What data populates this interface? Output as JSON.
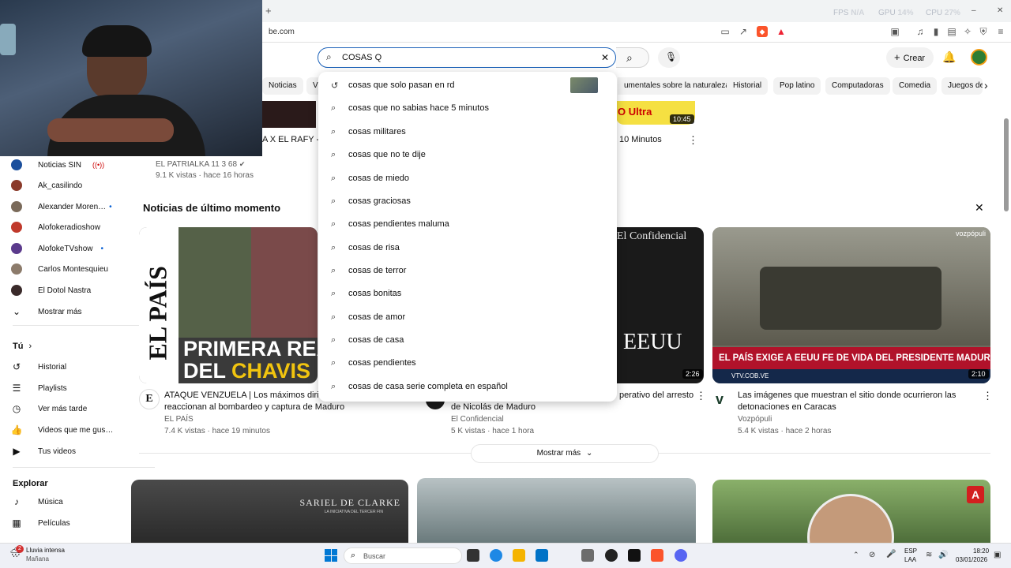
{
  "browser": {
    "url": "be.com",
    "stats": {
      "fps_label": "FPS",
      "fps_value": "N/A",
      "gpu_label": "GPU",
      "gpu_value": "14%",
      "cpu_label": "CPU",
      "cpu_value": "27%"
    },
    "new_tab": "+"
  },
  "header": {
    "search_value": "COSAS Q",
    "create_label": "Crear"
  },
  "chips": [
    "Noticias",
    "V",
    "umentales sobre la naturaleza",
    "Historial",
    "Pop latino",
    "Computadoras",
    "Comedia",
    "Juegos de"
  ],
  "top_partial": {
    "title_left": "A X EL RAFY - I",
    "title_right": "10 Minutos",
    "channel": "EL PATRIALKA 11 3 68",
    "meta": "9.1 K vistas · hace 16 horas",
    "duration": "10:45",
    "thumb_text": "O   Ultra"
  },
  "sidebar": {
    "subs": [
      {
        "name": "Noticias SIN",
        "live": true,
        "color": "#1b4f9c"
      },
      {
        "name": "Ak_casilindo",
        "color": "#8a3a2a"
      },
      {
        "name": "Alexander Moren…",
        "dot": true,
        "color": "#7a6a5a"
      },
      {
        "name": "Alofokeradioshow",
        "color": "#c0392b"
      },
      {
        "name": "AlofokeTVshow",
        "dot": true,
        "color": "#5b3a8c"
      },
      {
        "name": "Carlos Montesquieu",
        "color": "#8c7b6b"
      },
      {
        "name": "El Dotol Nastra",
        "color": "#3a2a2a"
      }
    ],
    "show_more": "Mostrar más",
    "you_label": "Tú",
    "you_items": [
      "Historial",
      "Playlists",
      "Ver más tarde",
      "Videos que me gus…",
      "Tus videos"
    ],
    "explore_label": "Explorar",
    "explore_items": [
      "Música",
      "Películas"
    ]
  },
  "news": {
    "section_title": "Noticias de último momento",
    "cards": [
      {
        "title_line1": "ATAQUE VENZUELA | Los máximos dirig",
        "title_line2": "reaccionan al bombardeo y captura de Maduro",
        "channel": "EL PAÍS",
        "meta": "7.4 K vistas · hace 19 minutos",
        "thumb_big": "EL PAÍS",
        "thumb_line1": "PRIMERA REA",
        "thumb_line2": "DEL CHAVIS",
        "thumb_line2_red": "CHAVIS"
      },
      {
        "title_line1": "perativo del arresto",
        "title_line2": "de Nicolás de Maduro",
        "channel": "El Confidencial",
        "meta": "5 K vistas · hace 1 hora",
        "duration": "2:26",
        "thumb_brand": "El Confidencial",
        "thumb_text": "EEUU"
      },
      {
        "title_line1": "Las imágenes que muestran el sitio donde ocurrieron las",
        "title_line2": "detonaciones en Caracas",
        "channel": "Vozpópuli",
        "meta": "5.4 K vistas · hace 2 horas",
        "duration": "2:10",
        "thumb_brand": "vozpópuli",
        "thumb_caption": "EL PAÍS EXIGE A EEUU FE DE VIDA DEL PRESIDENTE MADURO",
        "thumb_ticker": "VTV.COB.VE"
      }
    ],
    "show_more": "Mostrar más"
  },
  "bottom": {
    "card1_text": "SARIEL DE CLARKE",
    "card1_sub": "LA INICIATIVA DEL TERCER FIN"
  },
  "dropdown": {
    "suggestions": [
      {
        "text": "cosas que solo pasan en rd",
        "type": "history"
      },
      {
        "text": "cosas que no sabias hace 5 minutos",
        "type": "search"
      },
      {
        "text": "cosas militares",
        "type": "search"
      },
      {
        "text": "cosas que no te dije",
        "type": "search"
      },
      {
        "text": "cosas de miedo",
        "type": "search"
      },
      {
        "text": "cosas graciosas",
        "type": "search"
      },
      {
        "text": "cosas pendientes maluma",
        "type": "search"
      },
      {
        "text": "cosas de risa",
        "type": "search"
      },
      {
        "text": "cosas de terror",
        "type": "search"
      },
      {
        "text": "cosas bonitas",
        "type": "search"
      },
      {
        "text": "cosas de amor",
        "type": "search"
      },
      {
        "text": "cosas de casa",
        "type": "search"
      },
      {
        "text": "cosas pendientes",
        "type": "search"
      },
      {
        "text": "cosas de casa serie completa en español",
        "type": "search"
      }
    ]
  },
  "taskbar": {
    "weather_text": "Lluvia intensa",
    "weather_sub": "Mañana",
    "weather_badge": "2",
    "search_placeholder": "Buscar",
    "lang": "ESP",
    "lang_sub": "LAA",
    "time": "18:20",
    "date": "03/01/2026"
  }
}
